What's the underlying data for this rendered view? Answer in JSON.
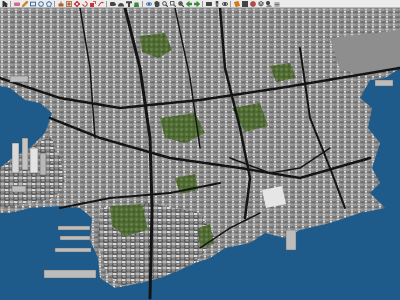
{
  "toolbar": {
    "buttons": [
      {
        "icon": "select-arrow-icon",
        "color": "#333333"
      },
      {
        "icon": "eraser-icon",
        "color": "#d46a8c"
      },
      {
        "icon": "pencil-icon",
        "color": "#c48a2a"
      },
      {
        "icon": "rectangle-icon",
        "color": "#3a6fb0"
      },
      {
        "icon": "circle-icon",
        "color": "#3a6fb0"
      },
      {
        "icon": "polygon-icon",
        "color": "#3a6fb0"
      },
      {
        "icon": "push-pull-icon",
        "color": "#b05a2a"
      },
      {
        "icon": "offset-icon",
        "color": "#b05a2a"
      },
      {
        "icon": "move-icon",
        "color": "#cc3333"
      },
      {
        "icon": "rotate-icon",
        "color": "#cc3333"
      },
      {
        "icon": "scale-icon",
        "color": "#cc3333"
      },
      {
        "icon": "follow-me-icon",
        "color": "#cc3333"
      },
      {
        "icon": "tape-measure-icon",
        "color": "#444444"
      },
      {
        "icon": "protractor-icon",
        "color": "#444444"
      },
      {
        "icon": "text-icon",
        "color": "#444444"
      },
      {
        "icon": "paint-bucket-icon",
        "color": "#3a8a3a"
      },
      {
        "icon": "orbit-icon",
        "color": "#3a6fb0"
      },
      {
        "icon": "pan-hand-icon",
        "color": "#444444"
      },
      {
        "icon": "zoom-icon",
        "color": "#444444"
      },
      {
        "icon": "zoom-window-icon",
        "color": "#444444"
      },
      {
        "icon": "zoom-extents-icon",
        "color": "#444444"
      },
      {
        "icon": "previous-view-icon",
        "color": "#3a8a3a"
      },
      {
        "icon": "next-view-icon",
        "color": "#3a8a3a"
      },
      {
        "icon": "position-camera-icon",
        "color": "#444444"
      },
      {
        "icon": "walk-icon",
        "color": "#444444"
      },
      {
        "icon": "look-around-icon",
        "color": "#444444"
      },
      {
        "icon": "section-plane-icon",
        "color": "#d47a1a"
      },
      {
        "icon": "components-icon",
        "color": "#444444"
      },
      {
        "icon": "materials-icon",
        "color": "#b04a4a"
      },
      {
        "icon": "layers-icon",
        "color": "#444444"
      },
      {
        "icon": "shadows-icon",
        "color": "#444444"
      },
      {
        "icon": "fog-icon",
        "color": "#444444"
      }
    ]
  },
  "scene": {
    "water_color": "#1f5b8a",
    "land_color": "#6e6e6e",
    "road_color": "#1a1a1a",
    "park_color": "#5f7a3a"
  }
}
